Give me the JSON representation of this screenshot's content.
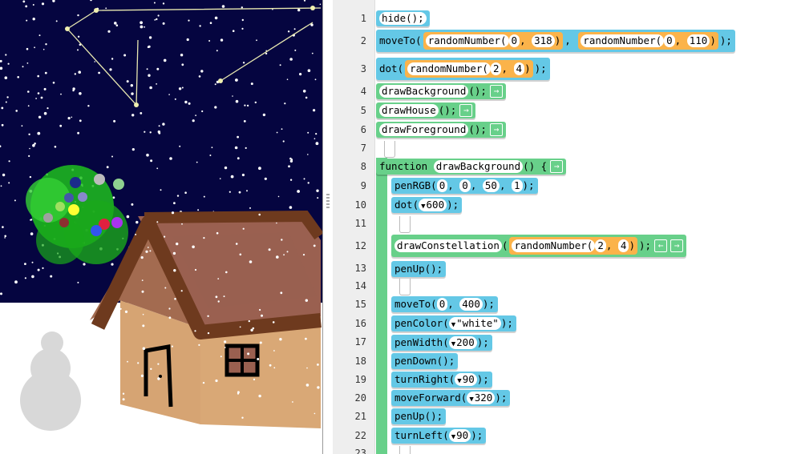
{
  "canvas": {
    "sky_color": "#050540",
    "snow_color": "#ffffff",
    "roof_color": "#6e3a1e",
    "wall_color": "#d6a473",
    "tree_color": "#22c322",
    "snowman_color": "#d8d8d8"
  },
  "editor": {
    "line_numbers": [
      "1",
      "2",
      "3",
      "4",
      "5",
      "6",
      "7",
      "8",
      "9",
      "10",
      "11",
      "12",
      "13",
      "14",
      "15",
      "16",
      "17",
      "18",
      "19",
      "20",
      "21",
      "22",
      "23"
    ],
    "lines": {
      "l1": {
        "fn": "hide();"
      },
      "l2": {
        "fn": "moveTo(",
        "a_fn": "randomNumber(",
        "a1": "0",
        "a_sep": ",",
        "a2": "318",
        "a_close": ")",
        "sep": ",",
        "b_fn": "randomNumber(",
        "b1": "0",
        "b_sep": ",",
        "b2": "110",
        "b_close": ")",
        "end": ");"
      },
      "l3": {
        "fn": "dot(",
        "a_fn": "randomNumber(",
        "a1": "2",
        "a_sep": ",",
        "a2": "4",
        "a_close": ")",
        "end": ");"
      },
      "l4": {
        "name": "drawBackground",
        "end": "();"
      },
      "l5": {
        "name": "drawHouse",
        "end": "();"
      },
      "l6": {
        "name": "drawForeground",
        "end": "();"
      },
      "l8": {
        "kw": "function",
        "name": "drawBackground",
        "end": "() {"
      },
      "l9": {
        "fn": "penRGB(",
        "a1": "0",
        "a2": "0",
        "a3": "50",
        "a4": "1",
        "sep": ",",
        "end": ");"
      },
      "l10": {
        "fn": "dot(",
        "v": "600",
        "end": ");"
      },
      "l12": {
        "name": "drawConstellation",
        "a_fn": "randomNumber(",
        "a1": "2",
        "a_sep": ",",
        "a2": "4",
        "a_close": ")",
        "end": ");"
      },
      "l13": {
        "fn": "penUp();"
      },
      "l15": {
        "fn": "moveTo(",
        "a1": "0",
        "sep": ",",
        "a2": "400",
        "end": ");"
      },
      "l16": {
        "fn": "penColor(",
        "v": "\"white\"",
        "end": ");"
      },
      "l17": {
        "fn": "penWidth(",
        "v": "200",
        "end": ");"
      },
      "l18": {
        "fn": "penDown();"
      },
      "l19": {
        "fn": "turnRight(",
        "v": "90",
        "end": ");"
      },
      "l20": {
        "fn": "moveForward(",
        "v": "320",
        "end": ");"
      },
      "l21": {
        "fn": "penUp();"
      },
      "l22": {
        "fn": "turnLeft(",
        "v": "90",
        "end": ");"
      }
    },
    "colors": {
      "blue": "#64c8e6",
      "green": "#68d08a",
      "orange": "#fbb34a"
    },
    "icons": {
      "arrow_right": "→",
      "arrow_left": "←",
      "dropdown": "▼"
    }
  }
}
